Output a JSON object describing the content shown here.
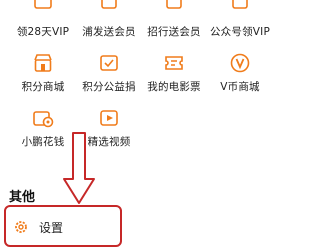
{
  "grid": {
    "row1": [
      "领28天VIP",
      "浦发送会员",
      "招行送会员",
      "公众号领VIP"
    ],
    "row2": [
      "积分商城",
      "积分公益捐",
      "我的电影票",
      "V币商城"
    ],
    "row3": [
      "小鹏花钱",
      "精选视频"
    ]
  },
  "other_section": {
    "title": "其他",
    "settings_label": "设置"
  },
  "colors": {
    "accent": "#f07c1b",
    "highlight": "#c62828"
  }
}
